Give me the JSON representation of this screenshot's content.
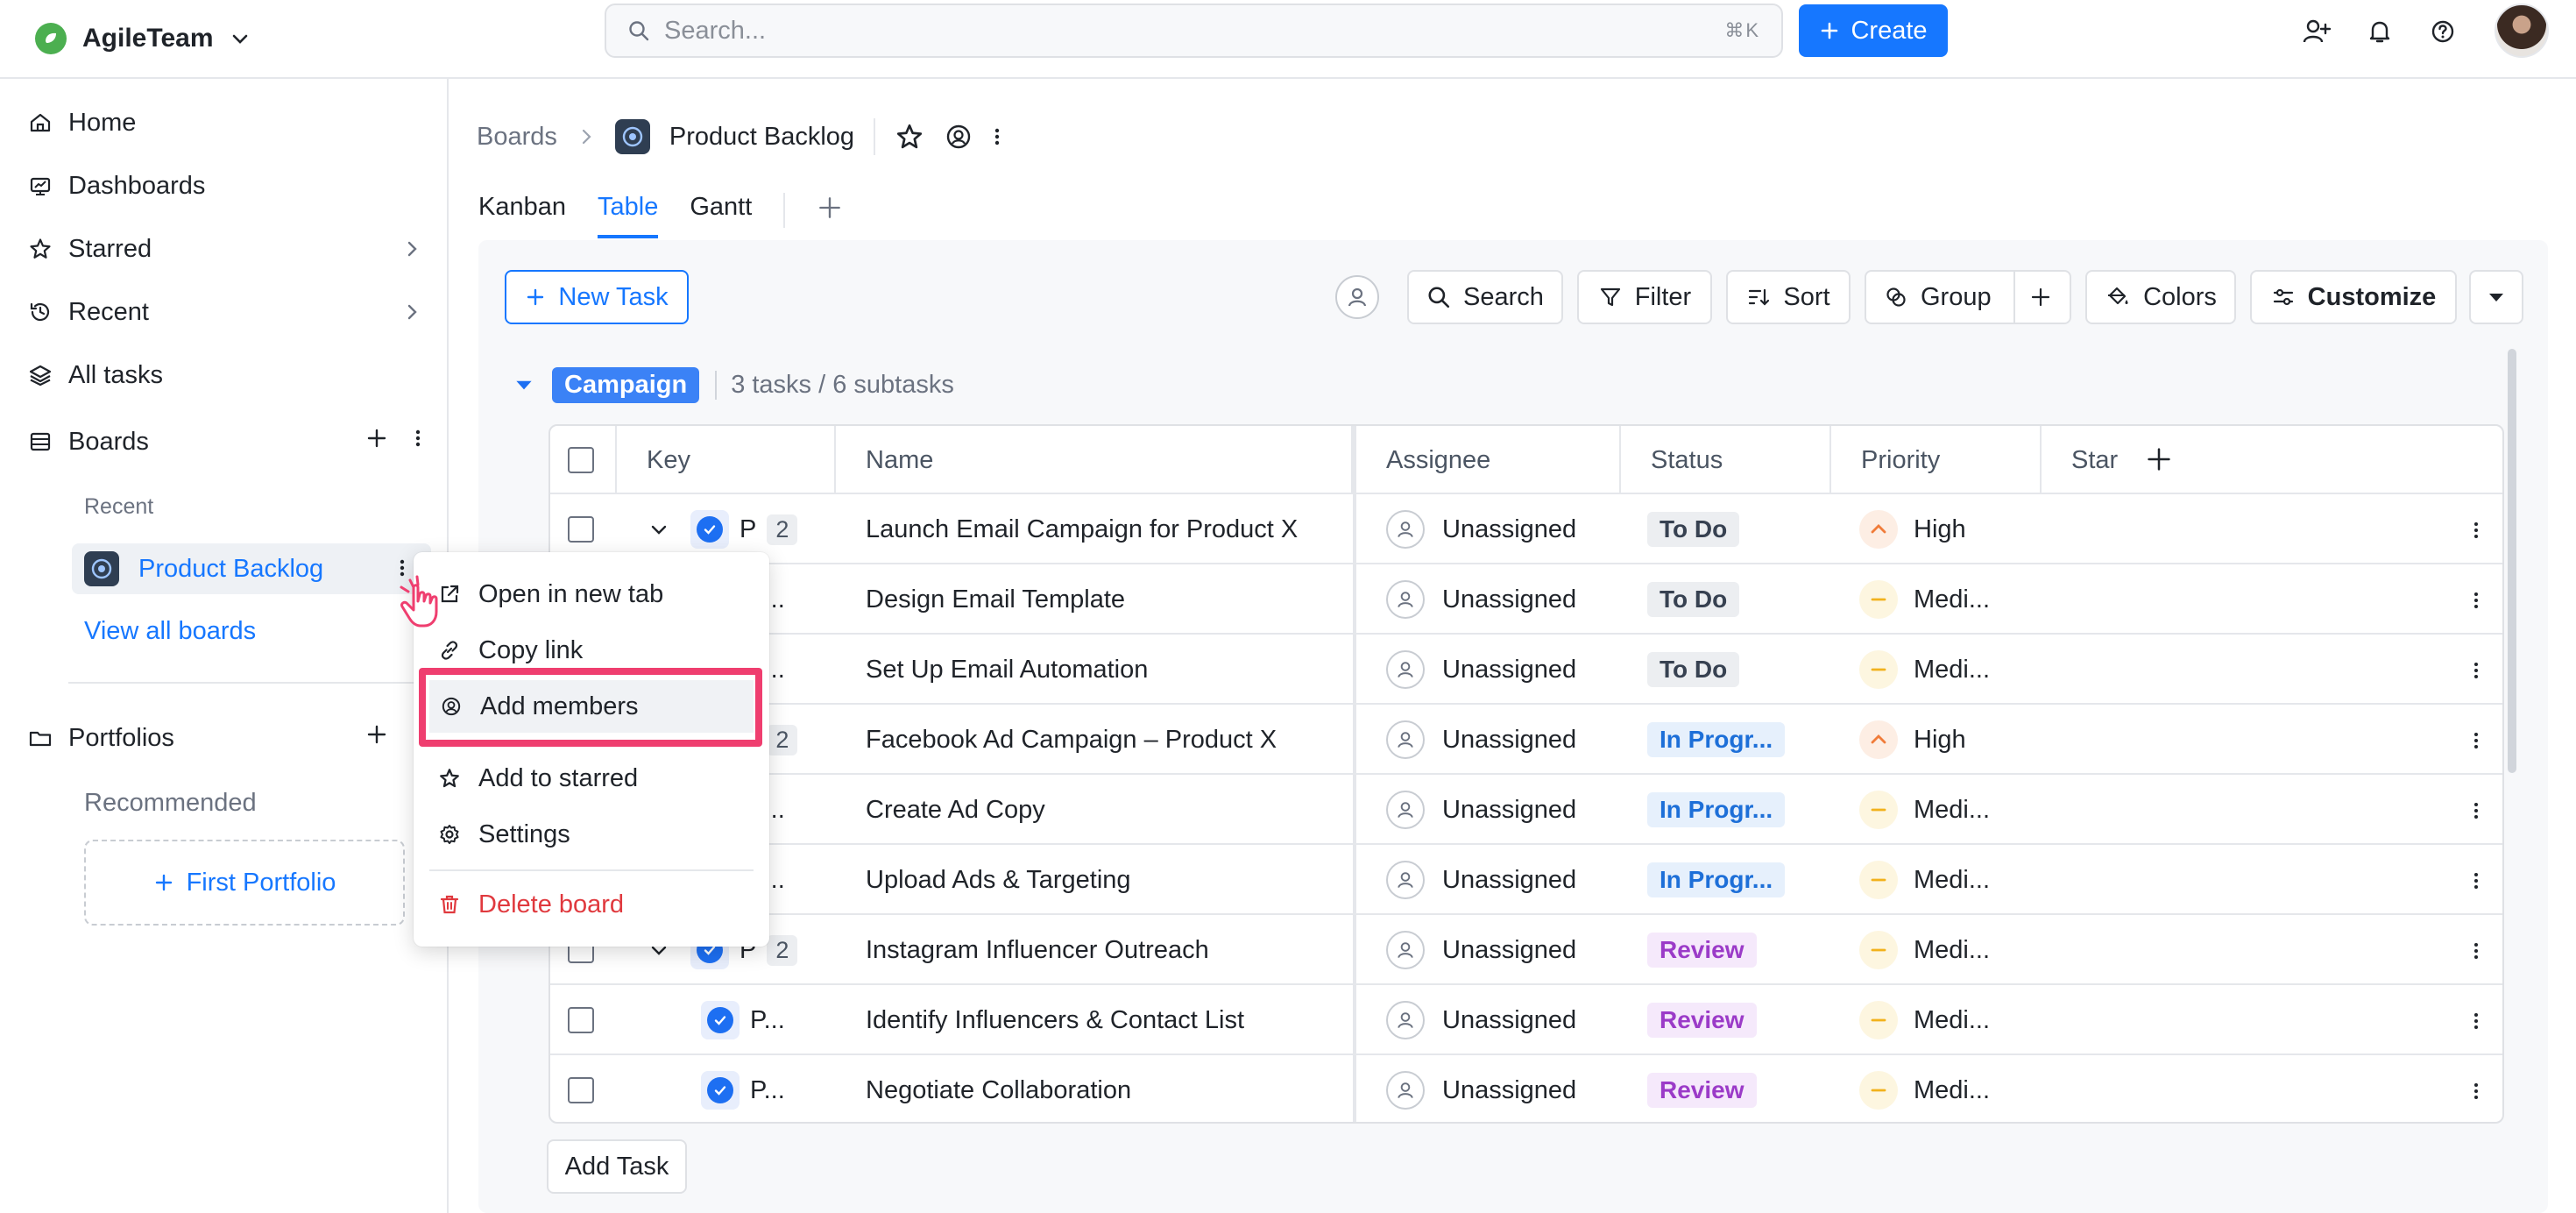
{
  "app": {
    "name": "AgileTeam"
  },
  "search": {
    "placeholder": "Search...",
    "shortcut": "⌘K"
  },
  "header": {
    "create_label": "Create"
  },
  "sidebar": {
    "nav": [
      {
        "label": "Home",
        "icon": "home-icon"
      },
      {
        "label": "Dashboards",
        "icon": "dashboard-icon"
      },
      {
        "label": "Starred",
        "icon": "star-icon"
      },
      {
        "label": "Recent",
        "icon": "clock-icon"
      },
      {
        "label": "All tasks",
        "icon": "layers-icon"
      }
    ],
    "boards_label": "Boards",
    "recent_label": "Recent",
    "current_board": "Product Backlog",
    "view_all_boards": "View all boards",
    "portfolios_label": "Portfolios",
    "recommended_label": "Recommended",
    "first_portfolio": "First Portfolio"
  },
  "context_menu": {
    "items": [
      "Open in new tab",
      "Copy link",
      "Add members",
      "Add to starred",
      "Settings"
    ],
    "danger_item": "Delete board"
  },
  "breadcrumb": {
    "root": "Boards",
    "title": "Product Backlog"
  },
  "tabs": [
    "Kanban",
    "Table",
    "Gantt"
  ],
  "active_tab": "Table",
  "toolbar": {
    "new_task": "New Task",
    "search": "Search",
    "filter": "Filter",
    "sort": "Sort",
    "group": "Group",
    "colors": "Colors",
    "customize": "Customize"
  },
  "group": {
    "name": "Campaign",
    "summary": "3 tasks / 6 subtasks"
  },
  "table": {
    "columns": [
      "Key",
      "Name",
      "Assignee",
      "Status",
      "Priority",
      "Star"
    ],
    "rows": [
      {
        "key": "P",
        "subtasks": "2",
        "name": "Launch Email Campaign for Product X",
        "assignee": "Unassigned",
        "status": "To Do",
        "status_kind": "todo",
        "priority": "High",
        "priority_kind": "high",
        "parent": true
      },
      {
        "key": "P...",
        "subtasks": "",
        "name": "Design Email Template",
        "assignee": "Unassigned",
        "status": "To Do",
        "status_kind": "todo",
        "priority": "Medi...",
        "priority_kind": "med",
        "parent": false
      },
      {
        "key": "P...",
        "subtasks": "",
        "name": "Set Up Email Automation",
        "assignee": "Unassigned",
        "status": "To Do",
        "status_kind": "todo",
        "priority": "Medi...",
        "priority_kind": "med",
        "parent": false
      },
      {
        "key": "P",
        "subtasks": "2",
        "name": "Facebook Ad Campaign – Product X",
        "assignee": "Unassigned",
        "status": "In Progr...",
        "status_kind": "prog",
        "priority": "High",
        "priority_kind": "high",
        "parent": true
      },
      {
        "key": "P...",
        "subtasks": "",
        "name": "Create Ad Copy",
        "assignee": "Unassigned",
        "status": "In Progr...",
        "status_kind": "prog",
        "priority": "Medi...",
        "priority_kind": "med",
        "parent": false
      },
      {
        "key": "P...",
        "subtasks": "",
        "name": "Upload Ads & Targeting",
        "assignee": "Unassigned",
        "status": "In Progr...",
        "status_kind": "prog",
        "priority": "Medi...",
        "priority_kind": "med",
        "parent": false
      },
      {
        "key": "P",
        "subtasks": "2",
        "name": "Instagram Influencer Outreach",
        "assignee": "Unassigned",
        "status": "Review",
        "status_kind": "review",
        "priority": "Medi...",
        "priority_kind": "med",
        "parent": true
      },
      {
        "key": "P...",
        "subtasks": "",
        "name": "Identify Influencers & Contact List",
        "assignee": "Unassigned",
        "status": "Review",
        "status_kind": "review",
        "priority": "Medi...",
        "priority_kind": "med",
        "parent": false
      },
      {
        "key": "P...",
        "subtasks": "",
        "name": "Negotiate Collaboration",
        "assignee": "Unassigned",
        "status": "Review",
        "status_kind": "review",
        "priority": "Medi...",
        "priority_kind": "med",
        "parent": false
      }
    ]
  },
  "add_task": "Add Task",
  "colors": {
    "accent": "#1677ff",
    "highlight": "#ef3e6f",
    "danger": "#e0393e"
  }
}
